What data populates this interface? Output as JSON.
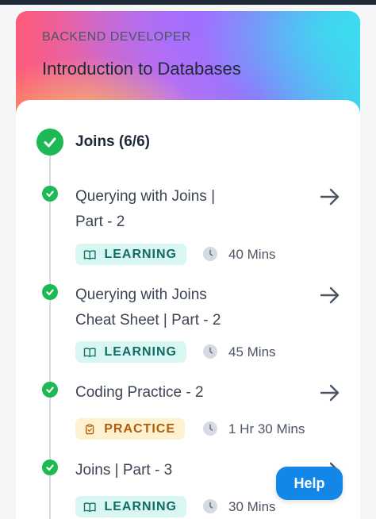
{
  "header": {
    "track": "BACKEND DEVELOPER",
    "course": "Introduction to Databases"
  },
  "section": {
    "title": "Joins (6/6)"
  },
  "items": [
    {
      "title_line1": "Querying with Joins |",
      "title_line2": "Part - 2",
      "type": "LEARNING",
      "duration": "40 Mins"
    },
    {
      "title_line1": "Querying with Joins",
      "title_line2": "Cheat Sheet | Part - 2",
      "type": "LEARNING",
      "duration": "45 Mins"
    },
    {
      "title_line1": "Coding Practice - 2",
      "title_line2": "",
      "type": "PRACTICE",
      "duration": "1 Hr 30 Mins"
    },
    {
      "title_line1": "Joins | Part - 3",
      "title_line2": "",
      "type": "LEARNING",
      "duration": "30 Mins"
    }
  ],
  "help_label": "Help",
  "colors": {
    "complete": "#1db954",
    "learning_bg": "#d8f6f2",
    "learning_text": "#136c63",
    "practice_bg": "#fdf1cf",
    "practice_text": "#b25b08",
    "help_button": "#1387e8"
  },
  "icons": [
    "check-icon",
    "arrow-right-icon",
    "book-icon",
    "clipboard-icon",
    "clock-icon"
  ]
}
